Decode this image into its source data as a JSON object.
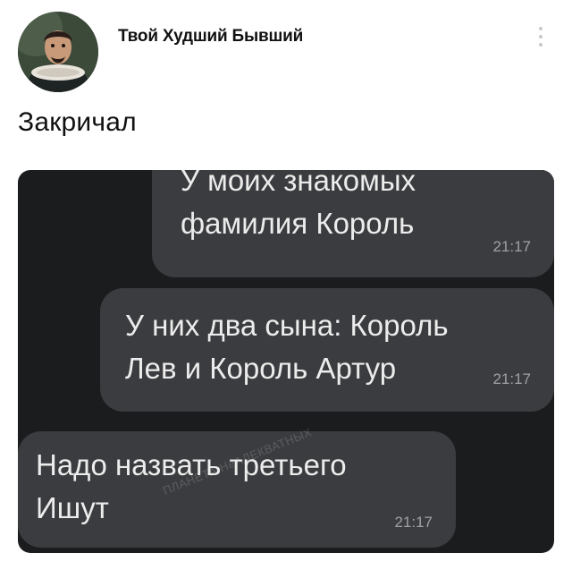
{
  "post": {
    "author": "Твой Худший Бывший",
    "text": "Закричал",
    "avatar_icon": "profile-avatar",
    "more_icon": "vertical-dots-icon"
  },
  "chat": {
    "messages": [
      {
        "text": "У моих знакомых\nфамилия Король",
        "time": "21:17"
      },
      {
        "text": "У них два сына: Король\nЛев и Король Артур",
        "time": "21:17"
      },
      {
        "text": "Надо назвать третьего\nИшут",
        "time": "21:17"
      }
    ],
    "watermark": "ПЛАНЕТА НеАДЕКВАТНЫХ"
  },
  "colors": {
    "chat_background": "#1b1c1e",
    "bubble": "#3b3c3f",
    "bubble_text": "#ececec",
    "timestamp": "#a0a1a4"
  }
}
